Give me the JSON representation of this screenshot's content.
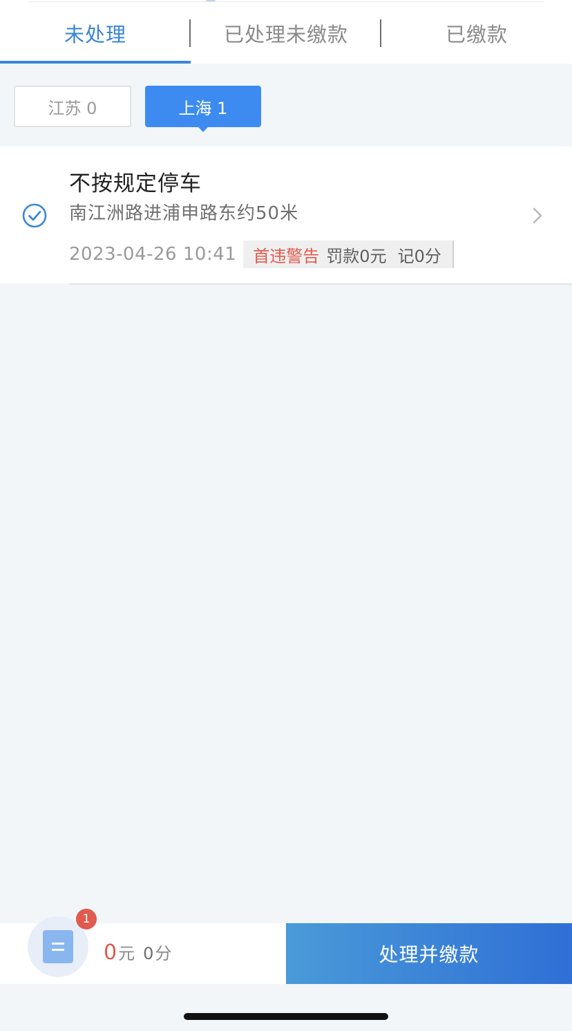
{
  "tabs": [
    {
      "label": "未处理",
      "active": true
    },
    {
      "label": "已处理未缴款",
      "active": false
    },
    {
      "label": "已缴款",
      "active": false
    }
  ],
  "regions": [
    {
      "label": "江苏 0",
      "active": false
    },
    {
      "label": "上海 1",
      "active": true
    }
  ],
  "violation": {
    "title": "不按规定停车",
    "location": "南江洲路进浦申路东约50米",
    "datetime": "2023-04-26 10:41",
    "warning_tag": "首违警告",
    "fine": "罚款0元",
    "points": "记0分",
    "selected": true
  },
  "summary": {
    "badge_count": "1",
    "amount": "0",
    "amount_unit": "元",
    "points": "0",
    "points_unit": "分"
  },
  "pay_button_label": "处理并缴款",
  "colors": {
    "accent": "#3a86d8",
    "chip_active": "#3d8bf0",
    "warning": "#e05a4e",
    "background": "#f2f6f8"
  },
  "icons": {
    "check": "check-circle-icon",
    "chevron": "chevron-right-icon",
    "document": "document-icon"
  }
}
